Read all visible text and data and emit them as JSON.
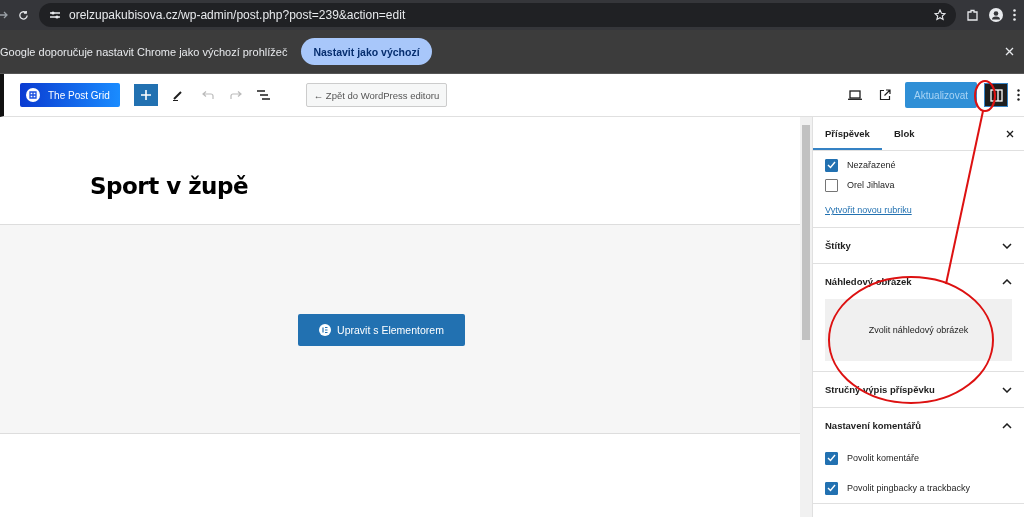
{
  "browser": {
    "url": "orelzupakubisova.cz/wp-admin/post.php?post=239&action=edit"
  },
  "infobar": {
    "message": "Google doporučuje nastavit Chrome jako výchozí prohlížeč",
    "button": "Nastavit jako výchozí"
  },
  "toolbar": {
    "logo_button": "The Post Grid",
    "back_button": "← Zpět do WordPress editoru",
    "update_button": "Aktualizovat",
    "sidebar_toggle": {
      "selected": true
    }
  },
  "editor": {
    "title": "Sport v župě",
    "elementor_button": "Upravit s Elementorem"
  },
  "sidebar": {
    "tabs": [
      {
        "label": "Příspěvek",
        "selected": true
      },
      {
        "label": "Blok",
        "selected": false
      }
    ],
    "sections": [
      {
        "kind": "checklist",
        "items": [
          {
            "label": "Nezařazené",
            "checked": true
          },
          {
            "label": "Orel Jihlava",
            "checked": false
          }
        ],
        "link": "Vytvořit novou rubriku"
      },
      {
        "kind": "panel",
        "title": "Štítky",
        "expanded": false
      },
      {
        "kind": "image",
        "title": "Náhledový obrázek",
        "expanded": true,
        "button": "Zvolit náhledový obrázek"
      },
      {
        "kind": "panel",
        "title": "Stručný výpis příspěvku",
        "expanded": false
      },
      {
        "kind": "checklist",
        "title": "Nastavení komentářů",
        "expanded": true,
        "items": [
          {
            "label": "Povolit komentáře",
            "checked": true
          },
          {
            "label": "Povolit pingbacky a trackbacky",
            "checked": true
          }
        ]
      }
    ]
  }
}
